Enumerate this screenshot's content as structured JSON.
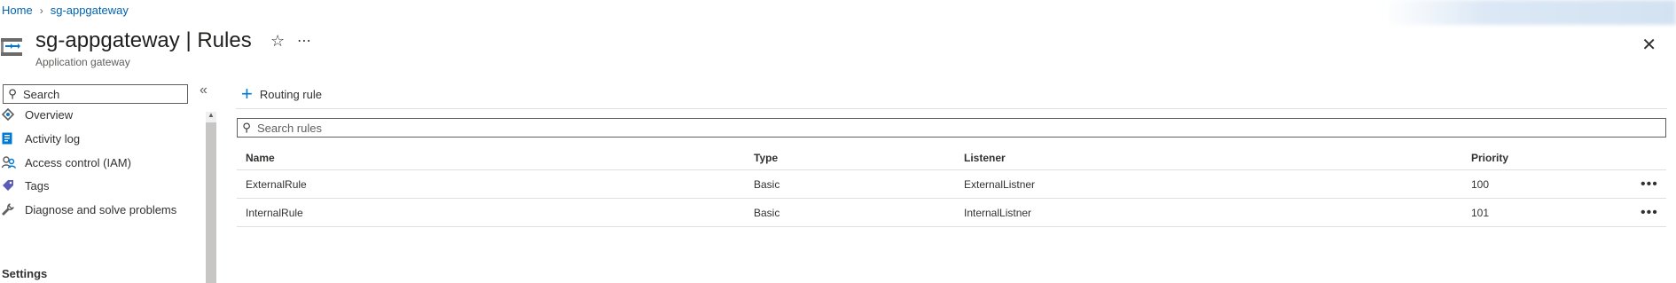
{
  "breadcrumb": {
    "home": "Home",
    "resource": "sg-appgateway"
  },
  "header": {
    "title": "sg-appgateway | Rules",
    "subtitle": "Application gateway",
    "favorite_icon": "star-icon",
    "more_icon": "ellipsis-icon",
    "close_icon": "close-icon"
  },
  "sidebar": {
    "search_placeholder": "Search",
    "collapse_glyph": "«",
    "items": [
      {
        "label": "Overview",
        "icon": "overview-icon"
      },
      {
        "label": "Activity log",
        "icon": "activity-log-icon"
      },
      {
        "label": "Access control (IAM)",
        "icon": "iam-icon"
      },
      {
        "label": "Tags",
        "icon": "tag-icon"
      },
      {
        "label": "Diagnose and solve problems",
        "icon": "wrench-icon"
      }
    ],
    "section": "Settings"
  },
  "toolbar": {
    "add_rule_label": "Routing rule"
  },
  "rules": {
    "search_placeholder": "Search rules",
    "columns": {
      "name": "Name",
      "type": "Type",
      "listener": "Listener",
      "priority": "Priority"
    },
    "rows": [
      {
        "name": "ExternalRule",
        "type": "Basic",
        "listener": "ExternalListner",
        "priority": "100"
      },
      {
        "name": "InternalRule",
        "type": "Basic",
        "listener": "InternalListner",
        "priority": "101"
      }
    ],
    "row_actions_glyph": "•••"
  },
  "colors": {
    "link": "#0063b1",
    "accent": "#0078d4",
    "text": "#323130"
  }
}
